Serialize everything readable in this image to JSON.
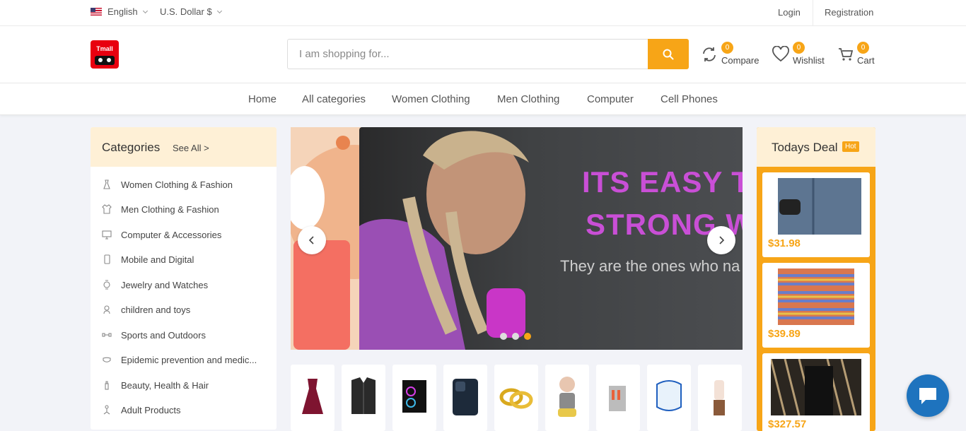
{
  "topbar": {
    "language": "English",
    "currency": "U.S. Dollar $",
    "login": "Login",
    "registration": "Registration"
  },
  "header": {
    "logo_text": "Tmall",
    "search_placeholder": "I am shopping for...",
    "compare": {
      "label": "Compare",
      "count": "0"
    },
    "wishlist": {
      "label": "Wishlist",
      "count": "0"
    },
    "cart": {
      "label": "Cart",
      "count": "0"
    }
  },
  "nav": [
    "Home",
    "All categories",
    "Women Clothing",
    "Men Clothing",
    "Computer",
    "Cell Phones"
  ],
  "categories": {
    "title": "Categories",
    "see_all": "See All >",
    "items": [
      "Women Clothing & Fashion",
      "Men Clothing & Fashion",
      "Computer & Accessories",
      "Mobile and Digital",
      "Jewelry and Watches",
      "children and toys",
      "Sports and Outdoors",
      "Epidemic prevention and medic...",
      "Beauty, Health & Hair",
      "Adult Products"
    ]
  },
  "slider": {
    "headline_1": "ITS EASY TO",
    "headline_2": "STRONG W",
    "subtext": "They are the ones who na",
    "active_dot": 3
  },
  "todays_deal": {
    "title": "Todays Deal",
    "badge": "Hot",
    "items": [
      {
        "price": "$31.98"
      },
      {
        "price": "$39.89"
      },
      {
        "price": "$327.57"
      }
    ]
  },
  "colors": {
    "accent": "#f7a517",
    "headline": "#c94fd6",
    "chat": "#1e73be"
  }
}
